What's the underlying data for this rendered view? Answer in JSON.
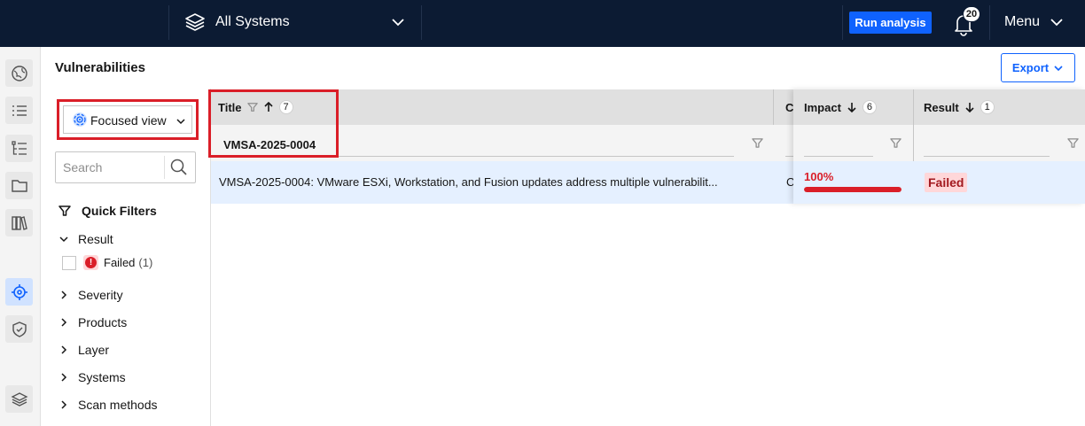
{
  "topbar": {
    "system_selector": "All Systems",
    "run_analysis": "Run analysis",
    "notifications_count": "20",
    "menu": "Menu"
  },
  "page": {
    "title": "Vulnerabilities",
    "export": "Export"
  },
  "filters": {
    "view_selector": "Focused view",
    "search_placeholder": "Search",
    "quick_filters": "Quick Filters",
    "groups": {
      "result": "Result",
      "severity": "Severity",
      "products": "Products",
      "layer": "Layer",
      "systems": "Systems",
      "scan_methods": "Scan methods"
    },
    "result_option": {
      "label": "Failed",
      "count": "(1)"
    }
  },
  "table": {
    "columns": {
      "title": {
        "label": "Title",
        "count": "7",
        "filter_value": "VMSA-2025-0004"
      },
      "c": {
        "label": "C"
      },
      "impact": {
        "label": "Impact",
        "count": "6"
      },
      "result": {
        "label": "Result",
        "count": "1"
      }
    },
    "rows": [
      {
        "title": "VMSA-2025-0004: VMware ESXi, Workstation, and Fusion updates address multiple vulnerabilit...",
        "c": "C",
        "impact_label": "100%",
        "impact_fraction": 1.0,
        "result": "Failed"
      }
    ]
  },
  "colors": {
    "topbar_bg": "#0c1b33",
    "primary": "#0f62fe",
    "danger": "#da1e28",
    "selected_row": "#e5f0ff"
  }
}
